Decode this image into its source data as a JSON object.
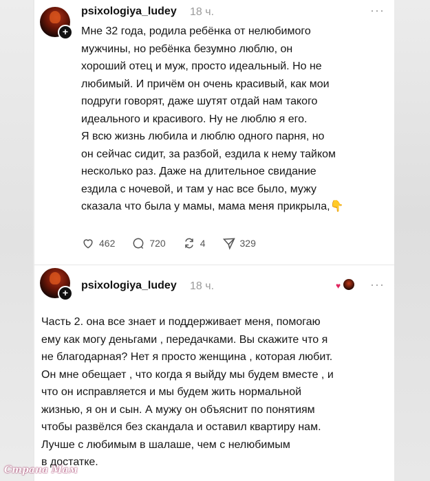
{
  "post1": {
    "username": "psixologiya_ludey",
    "time": "18 ч.",
    "text": "Мне 32 года, родила ребёнка от нелюбимого\nмужчины, но ребёнка безумно люблю, он\nхороший отец и муж, просто идеальный. Но не\nлюбимый. И причём он очень красивый, как мои\nподруги говорят, даже шутят отдай нам такого\nидеального и красивого. Ну не люблю я его.\nЯ всю жизнь любила и люблю одного парня, но\nон сейчас сидит, за разбой, ездила к нему тайком\nнесколько раз. Даже на длительное свидание\nездила с ночевой, и там у нас все было, мужу\nсказала что была у мамы, мама меня прикрыла,👇",
    "likes": "462",
    "comments": "720",
    "reposts": "4",
    "shares": "329",
    "icons": {
      "like": "heart-icon",
      "comment": "comment-icon",
      "repost": "repost-icon",
      "share": "share-icon"
    }
  },
  "post2": {
    "username": "psixologiya_ludey",
    "time": "18 ч.",
    "text": "Часть 2. она все знает и поддерживает меня, помогаю\nему как могу деньгами , передачками. Вы скажите что я\nне благодарная? Нет я просто женщина , которая любит.\nОн мне обещает , что когда я выйду мы будем вместе , и\nчто он исправляется и мы будем жить нормальной\nжизнью, я он и сын. А мужу он объяснит по понятиям\nчтобы развёлся без скандала и оставил квартиру нам.\nЛучше с любимым в шалаше, чем с нелюбимым\nв достатке."
  },
  "more_label": "···",
  "plus_label": "+",
  "reaction_heart": "♥",
  "watermark": "Страна Мам",
  "colors": {
    "accent_heart": "#e0245e",
    "muted": "#9a9a9a",
    "text": "#151515"
  }
}
